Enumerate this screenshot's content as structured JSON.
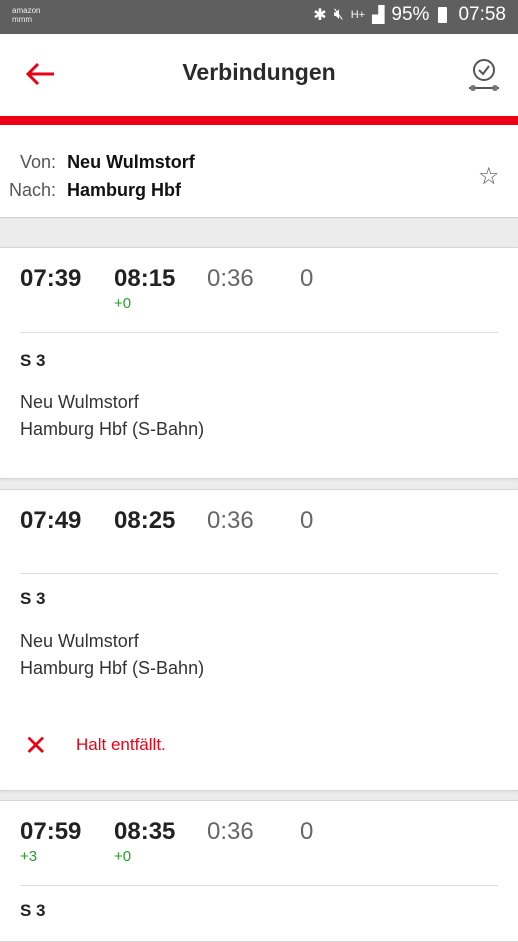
{
  "status_bar": {
    "carrier_line1": "amazon",
    "carrier_line2": "mmm",
    "icons": [
      "bluetooth-icon",
      "mute-icon",
      "hplus-signal-icon",
      "signal-icon"
    ],
    "battery": "95%",
    "time": "07:58"
  },
  "header": {
    "title": "Verbindungen",
    "back_icon": "arrow-left-icon",
    "right_icon": "clock-check-icon"
  },
  "route": {
    "from_label": "Von:",
    "from_value": "Neu Wulmstorf",
    "to_label": "Nach:",
    "to_value": "Hamburg Hbf",
    "favorite_icon": "star-outline-icon"
  },
  "connections": [
    {
      "dep": "07:39",
      "arr": "08:15",
      "dep_delay": "",
      "arr_delay": "+0",
      "duration": "0:36",
      "changes": "0",
      "line": "S 3",
      "from": "Neu Wulmstorf",
      "to": "Hamburg Hbf (S-Bahn)",
      "warning": ""
    },
    {
      "dep": "07:49",
      "arr": "08:25",
      "dep_delay": "",
      "arr_delay": "",
      "duration": "0:36",
      "changes": "0",
      "line": "S 3",
      "from": "Neu Wulmstorf",
      "to": "Hamburg Hbf (S-Bahn)",
      "warning": "Halt entfällt."
    },
    {
      "dep": "07:59",
      "arr": "08:35",
      "dep_delay": "+3",
      "arr_delay": "+0",
      "duration": "0:36",
      "changes": "0",
      "line": "S 3"
    }
  ],
  "colors": {
    "accent": "#ec0016",
    "delay_green": "#2a9d2a"
  }
}
